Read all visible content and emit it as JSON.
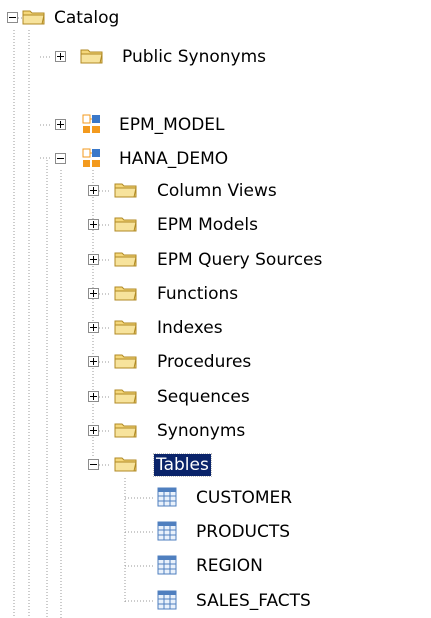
{
  "tree": {
    "root": {
      "label": "Catalog",
      "icon": "folder-icon",
      "expanded": true
    },
    "public_synonyms": {
      "label": "Public Synonyms",
      "icon": "folder-icon",
      "expanded": false
    },
    "schemas": [
      {
        "label": "EPM_MODEL",
        "icon": "schema-icon",
        "expanded": false
      },
      {
        "label": "HANA_DEMO",
        "icon": "schema-icon",
        "expanded": true,
        "folders": [
          {
            "label": "Column Views",
            "expanded": false
          },
          {
            "label": "EPM Models",
            "expanded": false
          },
          {
            "label": "EPM Query Sources",
            "expanded": false
          },
          {
            "label": "Functions",
            "expanded": false
          },
          {
            "label": "Indexes",
            "expanded": false
          },
          {
            "label": "Procedures",
            "expanded": false
          },
          {
            "label": "Sequences",
            "expanded": false
          },
          {
            "label": "Synonyms",
            "expanded": false
          },
          {
            "label": "Tables",
            "expanded": true,
            "selected": true
          }
        ],
        "tables": [
          {
            "label": "CUSTOMER",
            "icon": "table-icon"
          },
          {
            "label": "PRODUCTS",
            "icon": "table-icon"
          },
          {
            "label": "REGION",
            "icon": "table-icon"
          },
          {
            "label": "SALES_FACTS",
            "icon": "table-icon"
          }
        ]
      }
    ]
  },
  "colors": {
    "folder_fill": "#f5d77a",
    "folder_edge": "#b08a24",
    "schema_orange": "#f39a1e",
    "schema_blue": "#3a78c9",
    "table_grid": "#4f7fbf",
    "selection": "#0a246a",
    "tree_line": "#9a9a9a"
  }
}
